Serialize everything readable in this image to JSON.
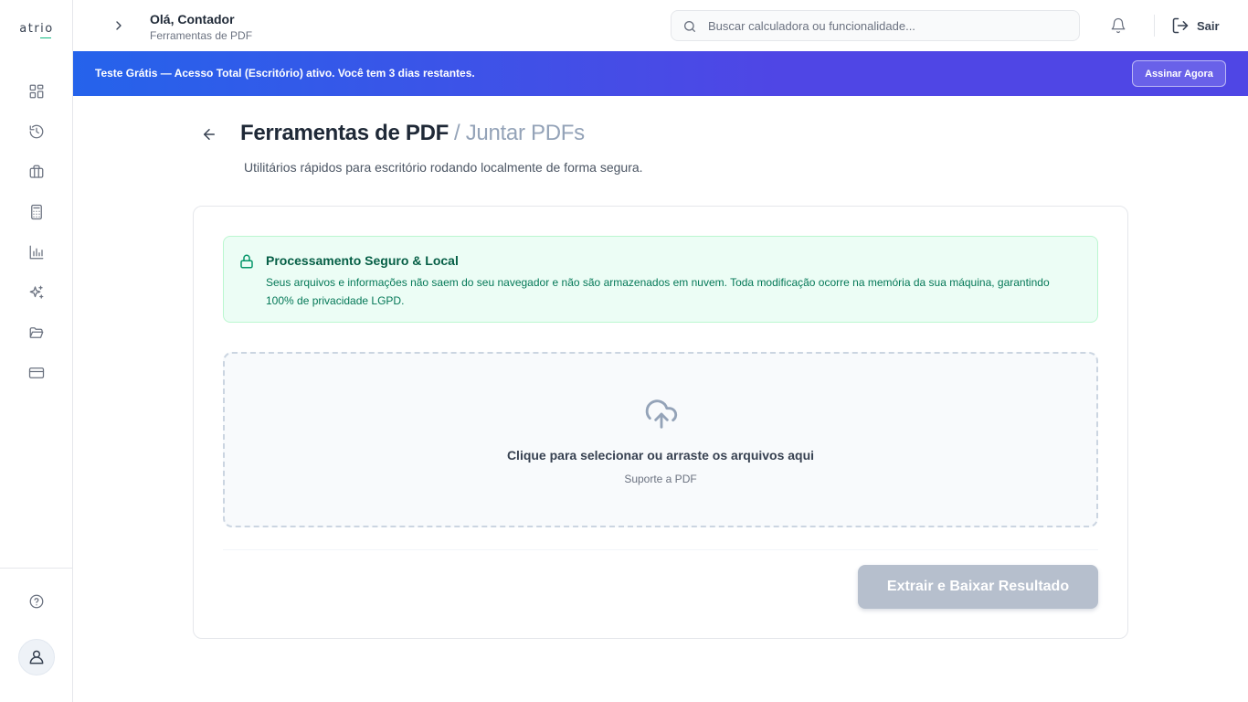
{
  "sidebar": {
    "logo": "atrio",
    "nav_icons": [
      "dashboard-icon",
      "history-icon",
      "briefcase-icon",
      "calculator-icon",
      "bar-chart-icon",
      "sparkles-icon",
      "folder-open-icon",
      "credit-card-icon"
    ],
    "bottom_icons": [
      "help-icon",
      "user-icon"
    ]
  },
  "header": {
    "greeting": "Olá, Contador",
    "subtitle": "Ferramentas de PDF",
    "search_placeholder": "Buscar calculadora ou funcionalidade...",
    "logout_label": "Sair"
  },
  "banner": {
    "text_prefix": "Teste Grátis — Acesso Total (Escritório) ativo. Você tem ",
    "days": "3 dias",
    "text_suffix": " restantes.",
    "button_label": "Assinar Agora"
  },
  "main": {
    "title": "Ferramentas de PDF",
    "title_sub": "/ Juntar PDFs",
    "description": "Utilitários rápidos para escritório rodando localmente de forma segura.",
    "alert": {
      "title": "Processamento Seguro & Local",
      "body": "Seus arquivos e informações não saem do seu navegador e não são armazenados em nuvem. Toda modificação ocorre na memória da sua máquina, garantindo 100% de privacidade LGPD."
    },
    "dropzone": {
      "title": "Clique para selecionar ou arraste os arquivos aqui",
      "subtitle": "Suporte a PDF"
    },
    "submit_label": "Extrair e Baixar Resultado"
  },
  "colors": {
    "accent_blue": "#2563eb",
    "accent_indigo": "#4f46e5",
    "success_bg": "#ecfdf5",
    "success_text": "#065f46",
    "disabled_button": "#b6bfcd"
  }
}
